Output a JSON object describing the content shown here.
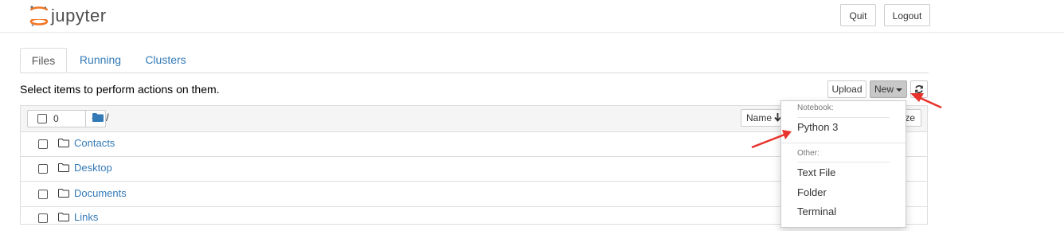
{
  "header": {
    "logo_text": "jupyter",
    "quit_label": "Quit",
    "logout_label": "Logout"
  },
  "tabs": [
    {
      "label": "Files",
      "active": true
    },
    {
      "label": "Running",
      "active": false
    },
    {
      "label": "Clusters",
      "active": false
    }
  ],
  "toolbar": {
    "notice": "Select items to perform actions on them.",
    "upload_label": "Upload",
    "new_label": "New",
    "refresh_icon": "refresh-icon"
  },
  "list": {
    "selected_count": "0",
    "breadcrumb": "/",
    "sort_label": "Name",
    "size_label": "ze",
    "items": [
      {
        "name": "Contacts",
        "icon": "folder-icon"
      },
      {
        "name": "Desktop",
        "icon": "folder-icon"
      },
      {
        "name": "Documents",
        "icon": "folder-icon"
      },
      {
        "name": "Links",
        "icon": "folder-icon"
      }
    ]
  },
  "new_menu": {
    "notebook_header": "Notebook:",
    "notebook_items": [
      "Python 3"
    ],
    "other_header": "Other:",
    "other_items": [
      "Text File",
      "Folder",
      "Terminal"
    ]
  },
  "colors": {
    "link": "#337ab7",
    "annotation_arrow": "#e8322b",
    "jupyter_orange": "#f37726"
  }
}
